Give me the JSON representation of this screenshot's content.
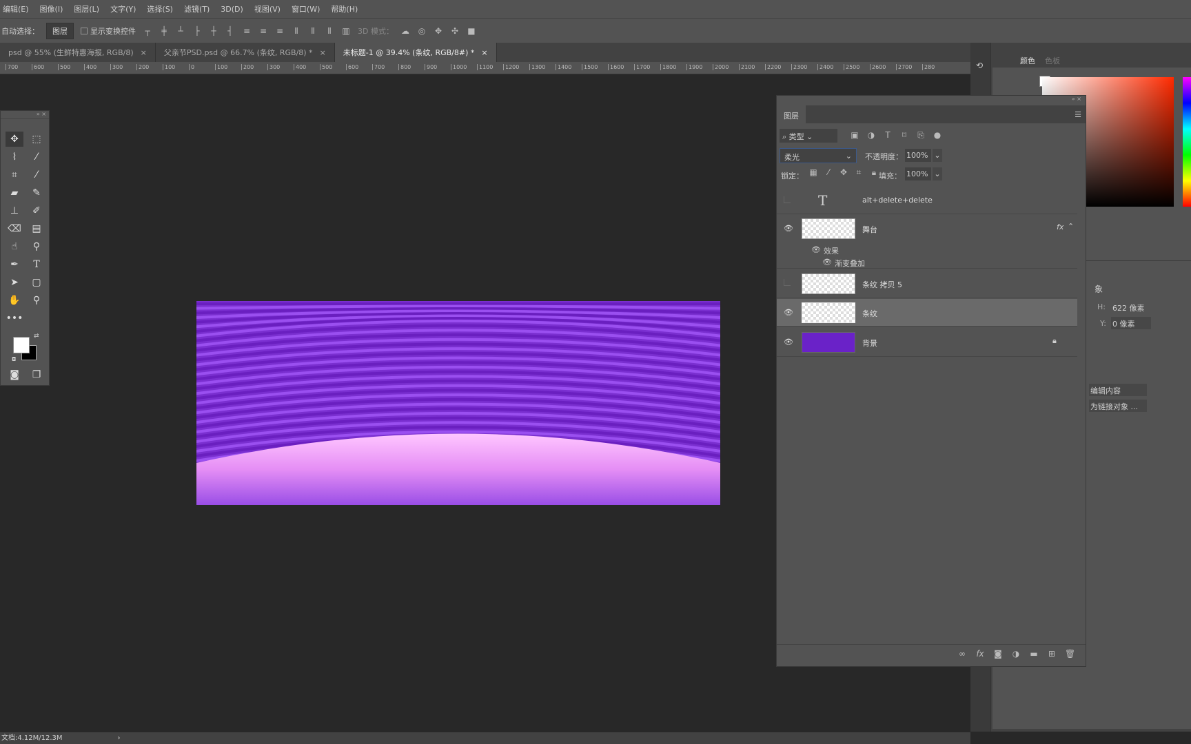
{
  "menu": [
    "编辑(E)",
    "图像(I)",
    "图层(L)",
    "文字(Y)",
    "选择(S)",
    "滤镜(T)",
    "3D(D)",
    "视图(V)",
    "窗口(W)",
    "帮助(H)"
  ],
  "options": {
    "auto_select_label": "自动选择：",
    "auto_select_value": "图层",
    "show_transform_label": "显示变换控件",
    "mode_3d_label": "3D 模式："
  },
  "tabs": [
    {
      "label": "psd @ 55% (生鲜特惠海报, RGB/8)",
      "active": false
    },
    {
      "label": "父亲节PSD.psd @ 66.7% (条纹, RGB/8) *",
      "active": false
    },
    {
      "label": "未标题-1 @ 39.4% (条纹, RGB/8#) *",
      "active": true
    }
  ],
  "tab_close": "×",
  "ruler_ticks": [
    "700",
    "600",
    "500",
    "400",
    "300",
    "200",
    "100",
    "0",
    "100",
    "200",
    "300",
    "400",
    "500",
    "600",
    "700",
    "800",
    "900",
    "1000",
    "1100",
    "1200",
    "1300",
    "1400",
    "1500",
    "1600",
    "1700",
    "1800",
    "1900",
    "2000",
    "2100",
    "2200",
    "2300",
    "2400",
    "2500",
    "2600",
    "2700",
    "280"
  ],
  "layers_panel": {
    "title": "图层",
    "filter_label": "类型",
    "blend_mode": "柔光",
    "opacity_label": "不透明度：",
    "opacity": "100%",
    "lock_label": "锁定：",
    "fill_label": "填充：",
    "fill": "100%",
    "layers": [
      {
        "name": "alt+delete+delete",
        "type": "text",
        "visible": false
      },
      {
        "name": "舞台",
        "type": "pixel",
        "visible": true,
        "fx": "fx",
        "effects_label": "效果",
        "effects": [
          "渐变叠加"
        ]
      },
      {
        "name": "条纹 拷贝 5",
        "type": "pixel",
        "visible": false
      },
      {
        "name": "条纹",
        "type": "smart",
        "visible": true,
        "selected": true
      },
      {
        "name": "背景",
        "type": "fill",
        "visible": true,
        "locked": true,
        "color": "#6a22c8"
      }
    ]
  },
  "color_panel": {
    "tabs": [
      "颜色",
      "色板"
    ],
    "hue": "#ff2a00"
  },
  "properties": {
    "title_partial": "象",
    "h_label": "H:",
    "h_value": "622 像素",
    "y_label": "Y:",
    "y_value": "0 像素",
    "btn1": "编辑内容",
    "btn2": "为链接对象 ..."
  },
  "status": {
    "doc": "文档:4.12M/12.3M",
    "arrow": "›"
  },
  "colors": {
    "canvas_purple": "#7a2fd0",
    "stage_pink": "#f7a8f9",
    "ui_bg": "#535353"
  }
}
